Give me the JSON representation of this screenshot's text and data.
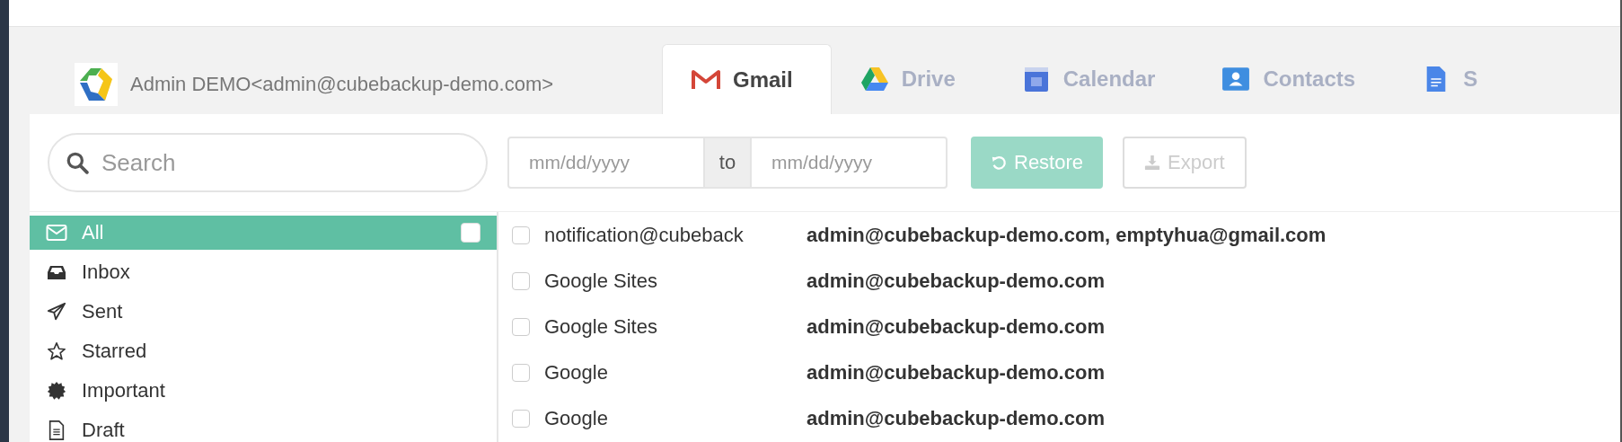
{
  "account": {
    "label": "Admin DEMO<admin@cubebackup-demo.com>"
  },
  "tabs": [
    {
      "label": "Gmail",
      "kind": "gmail",
      "selected": true
    },
    {
      "label": "Drive",
      "kind": "drive",
      "selected": false
    },
    {
      "label": "Calendar",
      "kind": "calendar",
      "selected": false
    },
    {
      "label": "Contacts",
      "kind": "contacts",
      "selected": false
    },
    {
      "label": "S",
      "kind": "sites",
      "selected": false
    }
  ],
  "toolbar": {
    "search": {
      "placeholder": "Search"
    },
    "date_from": {
      "placeholder": "mm/dd/yyyy"
    },
    "date_separator": "to",
    "date_to": {
      "placeholder": "mm/dd/yyyy"
    },
    "restore": {
      "label": "Restore",
      "disabled": true
    },
    "export": {
      "label": "Export",
      "disabled": true
    }
  },
  "sidebar": {
    "items": [
      {
        "label": "All",
        "kind": "all",
        "selected": true
      },
      {
        "label": "Inbox",
        "kind": "inbox",
        "selected": false
      },
      {
        "label": "Sent",
        "kind": "sent",
        "selected": false
      },
      {
        "label": "Starred",
        "kind": "starred",
        "selected": false
      },
      {
        "label": "Important",
        "kind": "important",
        "selected": false
      },
      {
        "label": "Draft",
        "kind": "draft",
        "selected": false
      }
    ],
    "select_all": {
      "checked": false
    }
  },
  "messages": [
    {
      "from": "notification@cubeback",
      "to": "admin@cubebackup-demo.com, emptyhua@gmail.com",
      "checked": false
    },
    {
      "from": "Google Sites",
      "to": "admin@cubebackup-demo.com",
      "checked": false
    },
    {
      "from": "Google Sites",
      "to": "admin@cubebackup-demo.com",
      "checked": false
    },
    {
      "from": "Google",
      "to": "admin@cubebackup-demo.com",
      "checked": false
    },
    {
      "from": "Google",
      "to": "admin@cubebackup-demo.com",
      "checked": false
    }
  ]
}
